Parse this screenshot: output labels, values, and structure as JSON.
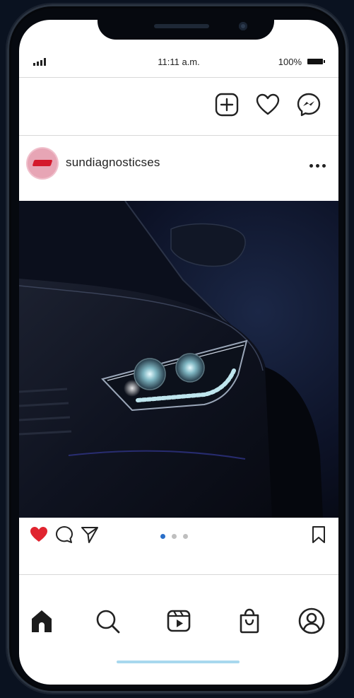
{
  "status_bar": {
    "time": "11:11 a.m.",
    "battery": "100%"
  },
  "post": {
    "username": "sundiagnosticses",
    "carousel_count": 3,
    "carousel_active": 0
  },
  "icons": {
    "topbar": [
      "add-icon",
      "heart-icon",
      "messenger-icon"
    ],
    "actions": [
      "heart-filled-icon",
      "comment-icon",
      "share-icon",
      "bookmark-icon"
    ],
    "nav": [
      "home-icon",
      "search-icon",
      "reels-icon",
      "shop-icon",
      "profile-icon"
    ]
  },
  "colors": {
    "like": "#e0242f",
    "carousel_active": "#2a6fc9",
    "home_indicator": "#a8d8ee"
  }
}
